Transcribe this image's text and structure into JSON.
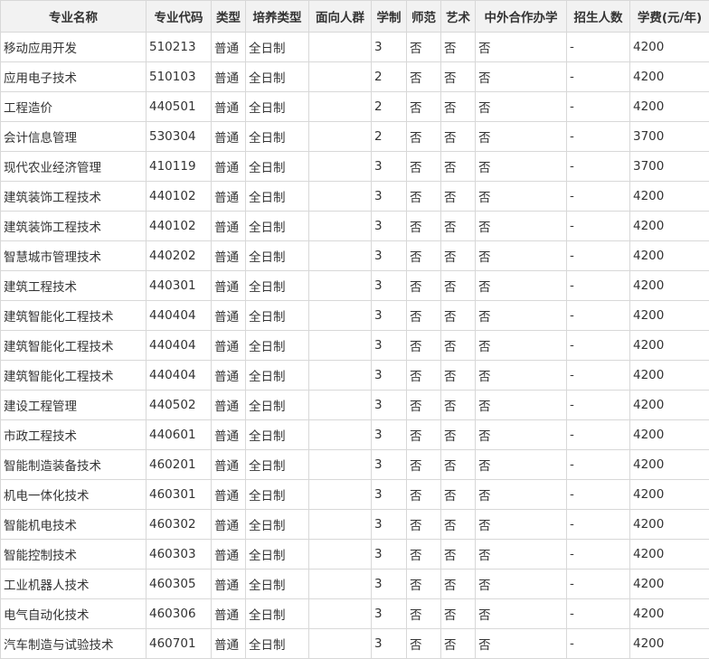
{
  "table": {
    "headers": [
      "专业名称",
      "专业代码",
      "类型",
      "培养类型",
      "面向人群",
      "学制",
      "师范",
      "艺术",
      "中外合作办学",
      "招生人数",
      "学费(元/年)"
    ],
    "rows": [
      [
        "移动应用开发",
        "510213",
        "普通",
        "全日制",
        "",
        "3",
        "否",
        "否",
        "否",
        "-",
        "4200"
      ],
      [
        "应用电子技术",
        "510103",
        "普通",
        "全日制",
        "",
        "2",
        "否",
        "否",
        "否",
        "-",
        "4200"
      ],
      [
        "工程造价",
        "440501",
        "普通",
        "全日制",
        "",
        "2",
        "否",
        "否",
        "否",
        "-",
        "4200"
      ],
      [
        "会计信息管理",
        "530304",
        "普通",
        "全日制",
        "",
        "2",
        "否",
        "否",
        "否",
        "-",
        "3700"
      ],
      [
        "现代农业经济管理",
        "410119",
        "普通",
        "全日制",
        "",
        "3",
        "否",
        "否",
        "否",
        "-",
        "3700"
      ],
      [
        "建筑装饰工程技术",
        "440102",
        "普通",
        "全日制",
        "",
        "3",
        "否",
        "否",
        "否",
        "-",
        "4200"
      ],
      [
        "建筑装饰工程技术",
        "440102",
        "普通",
        "全日制",
        "",
        "3",
        "否",
        "否",
        "否",
        "-",
        "4200"
      ],
      [
        "智慧城市管理技术",
        "440202",
        "普通",
        "全日制",
        "",
        "3",
        "否",
        "否",
        "否",
        "-",
        "4200"
      ],
      [
        "建筑工程技术",
        "440301",
        "普通",
        "全日制",
        "",
        "3",
        "否",
        "否",
        "否",
        "-",
        "4200"
      ],
      [
        "建筑智能化工程技术",
        "440404",
        "普通",
        "全日制",
        "",
        "3",
        "否",
        "否",
        "否",
        "-",
        "4200"
      ],
      [
        "建筑智能化工程技术",
        "440404",
        "普通",
        "全日制",
        "",
        "3",
        "否",
        "否",
        "否",
        "-",
        "4200"
      ],
      [
        "建筑智能化工程技术",
        "440404",
        "普通",
        "全日制",
        "",
        "3",
        "否",
        "否",
        "否",
        "-",
        "4200"
      ],
      [
        "建设工程管理",
        "440502",
        "普通",
        "全日制",
        "",
        "3",
        "否",
        "否",
        "否",
        "-",
        "4200"
      ],
      [
        "市政工程技术",
        "440601",
        "普通",
        "全日制",
        "",
        "3",
        "否",
        "否",
        "否",
        "-",
        "4200"
      ],
      [
        "智能制造装备技术",
        "460201",
        "普通",
        "全日制",
        "",
        "3",
        "否",
        "否",
        "否",
        "-",
        "4200"
      ],
      [
        "机电一体化技术",
        "460301",
        "普通",
        "全日制",
        "",
        "3",
        "否",
        "否",
        "否",
        "-",
        "4200"
      ],
      [
        "智能机电技术",
        "460302",
        "普通",
        "全日制",
        "",
        "3",
        "否",
        "否",
        "否",
        "-",
        "4200"
      ],
      [
        "智能控制技术",
        "460303",
        "普通",
        "全日制",
        "",
        "3",
        "否",
        "否",
        "否",
        "-",
        "4200"
      ],
      [
        "工业机器人技术",
        "460305",
        "普通",
        "全日制",
        "",
        "3",
        "否",
        "否",
        "否",
        "-",
        "4200"
      ],
      [
        "电气自动化技术",
        "460306",
        "普通",
        "全日制",
        "",
        "3",
        "否",
        "否",
        "否",
        "-",
        "4200"
      ],
      [
        "汽车制造与试验技术",
        "460701",
        "普通",
        "全日制",
        "",
        "3",
        "否",
        "否",
        "否",
        "-",
        "4200"
      ]
    ]
  }
}
